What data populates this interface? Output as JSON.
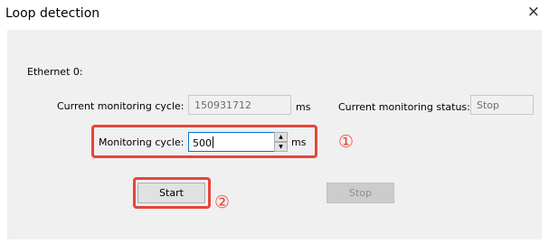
{
  "window": {
    "title": "Loop detection",
    "close_glyph": "×"
  },
  "section": {
    "ethernet_label": "Ethernet 0:"
  },
  "current_cycle": {
    "label": "Current monitoring cycle:",
    "value": "150931712",
    "unit": "ms"
  },
  "current_status": {
    "label": "Current monitoring status:",
    "value": "Stop"
  },
  "monitoring_cycle": {
    "label": "Monitoring cycle:",
    "value": "500",
    "unit": "ms",
    "spin_up_glyph": "▲",
    "spin_down_glyph": "▼"
  },
  "buttons": {
    "start_label": "Start",
    "stop_label": "Stop"
  },
  "annotations": {
    "marker_1": "①",
    "marker_2": "②",
    "highlight_color": "#e8453c"
  }
}
